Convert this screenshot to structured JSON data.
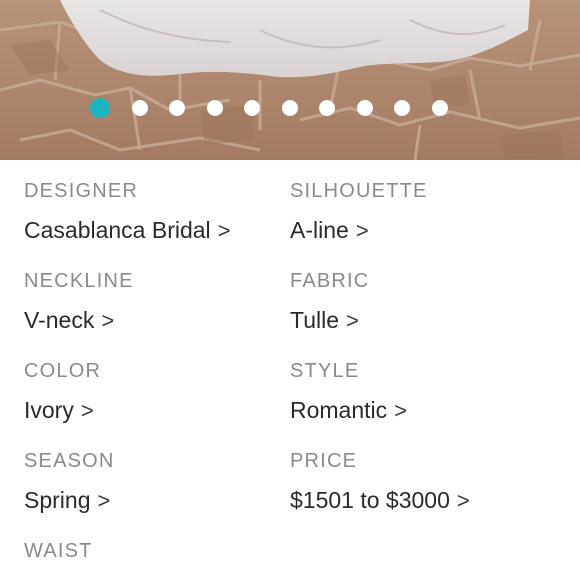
{
  "gallery": {
    "dot_count": 10,
    "active_index": 0,
    "accent_color": "#1ab5c1"
  },
  "details": [
    {
      "label": "DESIGNER",
      "value": "Casablanca Bridal"
    },
    {
      "label": "SILHOUETTE",
      "value": "A-line"
    },
    {
      "label": "NECKLINE",
      "value": "V-neck"
    },
    {
      "label": "FABRIC",
      "value": "Tulle"
    },
    {
      "label": "COLOR",
      "value": "Ivory"
    },
    {
      "label": "STYLE",
      "value": "Romantic"
    },
    {
      "label": "SEASON",
      "value": "Spring"
    },
    {
      "label": "PRICE",
      "value": "$1501 to $3000"
    },
    {
      "label": "WAIST",
      "value": ""
    }
  ],
  "chevron_glyph": ">"
}
